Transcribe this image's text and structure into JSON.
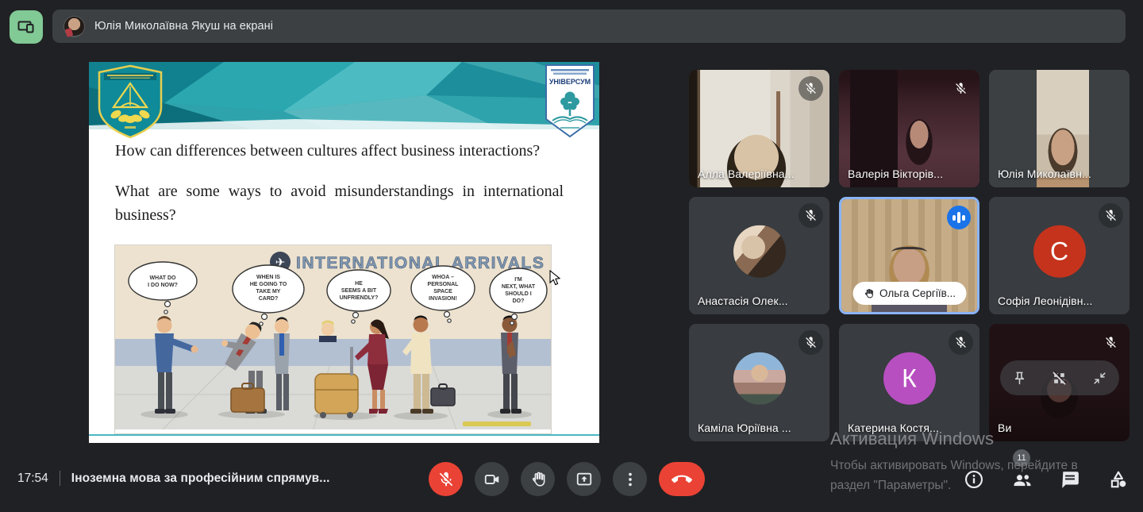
{
  "top_bar": {
    "presenting": "Юлія Миколаївна Якуш на екрані"
  },
  "slide": {
    "badge_title": "УНІВЕРСУМ",
    "question1": "How can differences between cultures affect business interactions?",
    "question2": "What are some ways to avoid misunderstandings in international business?",
    "cartoon": {
      "title": "INTERNATIONAL ARRIVALS",
      "bubbles": [
        {
          "lines": [
            "WHAT DO",
            "I DO NOW?"
          ]
        },
        {
          "lines": [
            "WHEN IS",
            "HE GOING TO",
            "TAKE MY",
            "CARD?"
          ]
        },
        {
          "lines": [
            "HE",
            "SEEMS A BIT",
            "UNFRIENDLY?"
          ]
        },
        {
          "lines": [
            "WHOA –",
            "PERSONAL",
            "SPACE",
            "INVASION!"
          ]
        },
        {
          "lines": [
            "I'M",
            "NEXT, WHAT",
            "SHOULD I",
            "DO?"
          ]
        }
      ]
    }
  },
  "participants": [
    {
      "name": "Алла Валеріївна...",
      "kind": "video",
      "variant": "alla",
      "mic": "muted"
    },
    {
      "name": "Валерія Вікторів...",
      "kind": "video",
      "variant": "valeria",
      "mic": "muted-bare"
    },
    {
      "name": "Юлія Миколаївн...",
      "kind": "video",
      "variant": "yulia",
      "mic": "none"
    },
    {
      "name": "Анастасія Олек...",
      "kind": "avatar-photo",
      "variant": "anastasia",
      "mic": "muted"
    },
    {
      "name": "Ольга Сергіїв...",
      "kind": "video",
      "variant": "olha",
      "mic": "speaking",
      "hand_raised": true,
      "active": true
    },
    {
      "name": "Софія Леонідівн...",
      "kind": "avatar-letter",
      "letter": "С",
      "avatar_color": "#c5331d",
      "mic": "muted"
    },
    {
      "name": "Каміла Юріївна ...",
      "kind": "avatar-photo",
      "variant": "kamila",
      "mic": "muted"
    },
    {
      "name": "Катерина Костя...",
      "kind": "avatar-letter",
      "letter": "К",
      "avatar_color": "#b84fc1",
      "mic": "muted"
    },
    {
      "name": "Ви",
      "kind": "video",
      "variant": "self",
      "mic": "muted-bare",
      "hover_controls": true
    }
  ],
  "bottom_bar": {
    "time": "17:54",
    "meeting_name": "Іноземна мова за професійним спрямув..."
  },
  "participants_count": "11",
  "watermark": {
    "line1": "Активация Windows",
    "line2": "Чтобы активировать Windows, перейдите в",
    "line3": "раздел \"Параметры\"."
  },
  "colors": {
    "background": "#202124",
    "tile": "#3c4043",
    "accent_green": "#81c995",
    "accent_red": "#ea4335",
    "active_border": "#8ab4f8",
    "speaking_blue": "#1a73e8"
  }
}
